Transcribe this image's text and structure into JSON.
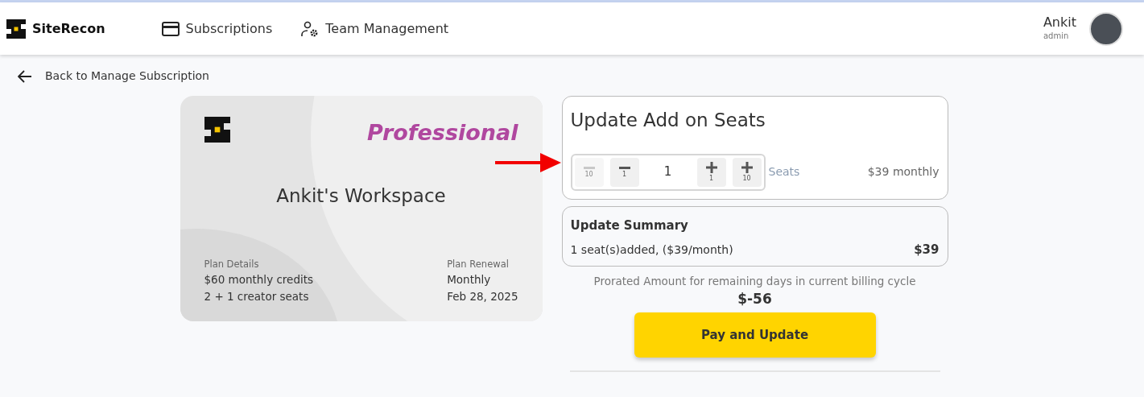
{
  "navbar": {
    "brand": "SiteRecon",
    "links": [
      {
        "label": "Subscriptions",
        "kind": "card",
        "selected": false
      },
      {
        "label": "Team Management",
        "kind": "team",
        "selected": false
      }
    ],
    "user": {
      "name": "Ankit",
      "role": "admin"
    }
  },
  "back_link": {
    "label": "Back to Manage Subscription"
  },
  "plan_card": {
    "plan": "Professional",
    "workspace": "Ankit's Workspace",
    "details": [
      {
        "heading": "Plan Details",
        "lines": [
          "$60 monthly credits",
          "2 + 1 creator seats"
        ]
      },
      {
        "heading": "Plan Renewal",
        "lines": [
          "Monthly",
          "Feb 28, 2025"
        ]
      }
    ]
  },
  "seats_panel": {
    "title": "Update Add on Seats",
    "stepper_left": [
      {
        "kind": "minus",
        "step": "10",
        "disabled": true
      },
      {
        "kind": "minus",
        "step": "1",
        "disabled": false
      }
    ],
    "value": "1",
    "stepper_right": [
      {
        "kind": "plus",
        "step": "1",
        "disabled": false
      },
      {
        "kind": "plus",
        "step": "10",
        "disabled": false
      }
    ],
    "unit": "Seats",
    "price": "$39 monthly"
  },
  "summary": {
    "title": "Update Summary",
    "line": "1 seat(s)added, ($39/month)",
    "amount": "$39"
  },
  "prorated": {
    "label": "Prorated Amount for remaining days in current billing cycle",
    "amount": "$-56"
  },
  "pay_button": "Pay and Update"
}
